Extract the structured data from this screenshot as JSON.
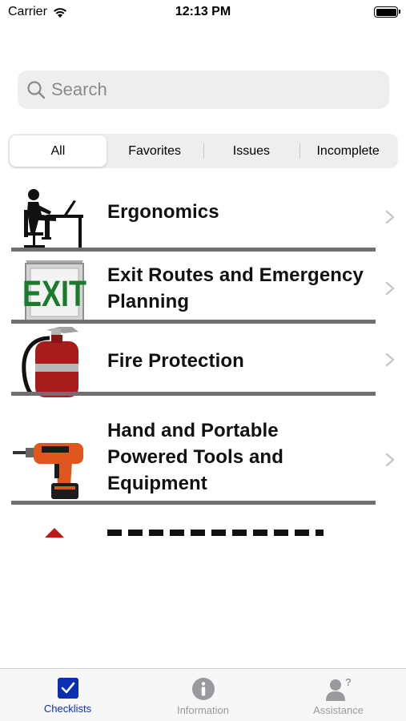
{
  "status_bar": {
    "carrier": "Carrier",
    "time": "12:13 PM"
  },
  "search": {
    "placeholder": "Search"
  },
  "segments": [
    {
      "label": "All",
      "selected": true
    },
    {
      "label": "Favorites",
      "selected": false
    },
    {
      "label": "Issues",
      "selected": false
    },
    {
      "label": "Incomplete",
      "selected": false
    }
  ],
  "list_items": [
    {
      "title": "Ergonomics",
      "icon": "ergonomics-icon"
    },
    {
      "title": "Exit Routes and Emergency Planning",
      "icon": "exit-sign-icon"
    },
    {
      "title": "Fire Protection",
      "icon": "fire-extinguisher-icon"
    },
    {
      "title": "Hand and Portable Powered Tools and Equipment",
      "icon": "power-drill-icon"
    }
  ],
  "tab_bar": [
    {
      "label": "Checklists",
      "icon": "checkbox-icon",
      "active": true
    },
    {
      "label": "Information",
      "icon": "info-icon",
      "active": false
    },
    {
      "label": "Assistance",
      "icon": "person-question-icon",
      "active": false
    }
  ],
  "colors": {
    "accent": "#0a2fb3",
    "separator": "#6f6f6f",
    "chevron": "#c4c4c7"
  }
}
